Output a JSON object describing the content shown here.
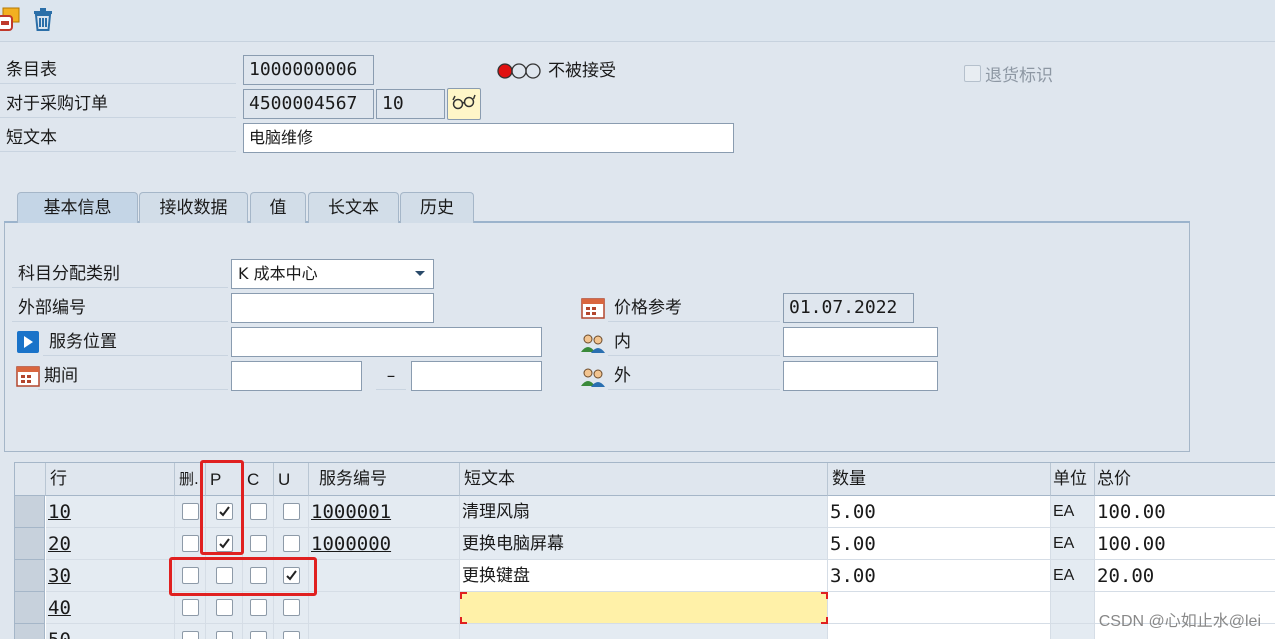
{
  "toolbar": {
    "icons": [
      "hold-icon",
      "trash-icon"
    ]
  },
  "header": {
    "entry_sheet_label": "条目表",
    "entry_sheet_value": "1000000006",
    "po_label": "对于采购订单",
    "po_number": "4500004567",
    "po_item": "10",
    "short_text_label": "短文本",
    "short_text_value": "电脑维修",
    "status_text": "不被接受",
    "return_flag_label": "退货标识"
  },
  "tabs": [
    {
      "label": "基本信息",
      "active": true
    },
    {
      "label": "接收数据",
      "active": false
    },
    {
      "label": "值",
      "active": false
    },
    {
      "label": "长文本",
      "active": false
    },
    {
      "label": "历史",
      "active": false
    }
  ],
  "basic": {
    "acct_assign_label": "科目分配类别",
    "acct_assign_value": "K 成本中心",
    "ext_number_label": "外部编号",
    "ext_number_value": "",
    "service_loc_label": "服务位置",
    "service_loc_value": "",
    "period_label": "期间",
    "period_from": "",
    "period_sep": "–",
    "period_to": "",
    "price_ref_label": "价格参考",
    "price_ref_value": "01.07.2022",
    "internal_label": "内",
    "internal_value": "",
    "external_label": "外",
    "external_value": ""
  },
  "grid": {
    "columns": [
      "行",
      "删.",
      "P",
      "C",
      "U",
      "服务编号",
      "短文本",
      "数量",
      "单位",
      "总价"
    ],
    "rows": [
      {
        "line": "10",
        "del": false,
        "p": true,
        "c": false,
        "u": false,
        "service": "1000001",
        "text": "清理风扇",
        "qty": "5.00",
        "unit": "EA",
        "total": "100.00"
      },
      {
        "line": "20",
        "del": false,
        "p": true,
        "c": false,
        "u": false,
        "service": "1000000",
        "text": "更换电脑屏幕",
        "qty": "5.00",
        "unit": "EA",
        "total": "100.00"
      },
      {
        "line": "30",
        "del": false,
        "p": false,
        "c": false,
        "u": true,
        "service": "",
        "text": "更换键盘",
        "qty": "3.00",
        "unit": "EA",
        "total": "20.00"
      },
      {
        "line": "40",
        "del": false,
        "p": false,
        "c": false,
        "u": false,
        "service": "",
        "text": "",
        "qty": "",
        "unit": "",
        "total": ""
      },
      {
        "line": "50",
        "del": false,
        "p": false,
        "c": false,
        "u": false,
        "service": "",
        "text": "",
        "qty": "",
        "unit": "",
        "total": ""
      }
    ]
  },
  "watermark": "CSDN @心如止水@lei",
  "colors": {
    "highlight_red": "#e02020",
    "input_focus_yellow": "#fff1a8"
  }
}
